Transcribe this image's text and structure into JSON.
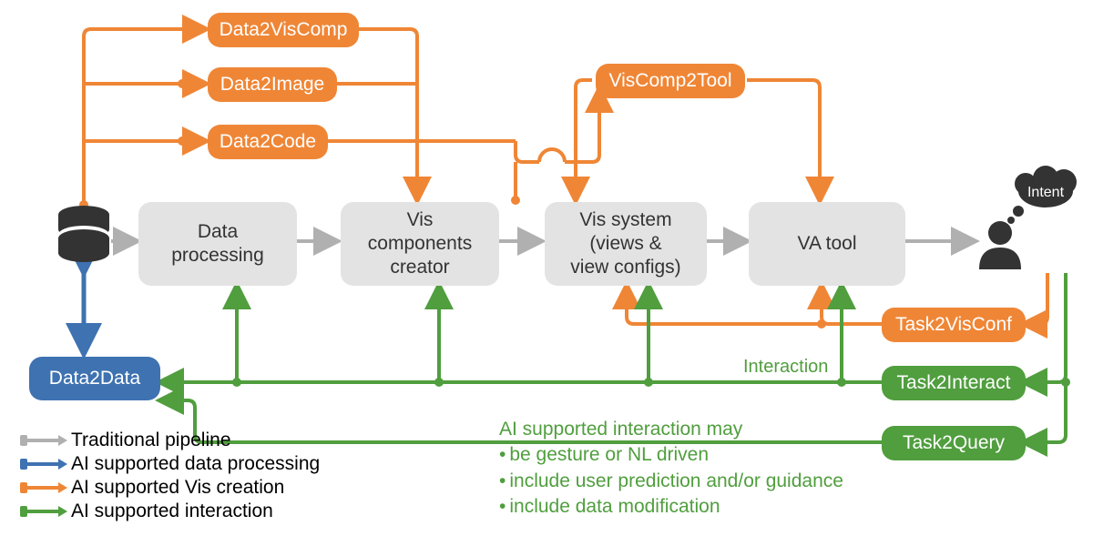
{
  "orange_boxes": {
    "data2viscomp": "Data2VisComp",
    "data2image": "Data2Image",
    "data2code": "Data2Code",
    "viscomp2tool": "VisComp2Tool",
    "task2visconf": "Task2VisConf"
  },
  "gray_boxes": {
    "data_processing": "Data\nprocessing",
    "vis_components": "Vis\ncomponents\ncreator",
    "vis_system": "Vis system\n(views &\nview configs)",
    "va_tool": "VA tool"
  },
  "blue_boxes": {
    "data2data": "Data2Data"
  },
  "green_boxes": {
    "task2interact": "Task2Interact",
    "task2query": "Task2Query"
  },
  "labels": {
    "intent": "Intent",
    "interaction": "Interaction"
  },
  "legend": {
    "traditional": "Traditional pipeline",
    "blue": "AI supported data processing",
    "orange": "AI supported Vis creation",
    "green": "AI supported interaction"
  },
  "note": {
    "title": "AI supported interaction may",
    "b1": "be gesture or NL driven",
    "b2": "include user prediction and/or guidance",
    "b3": "include data modification"
  },
  "colors": {
    "gray": "#b0b0b0",
    "orange": "#ef8636",
    "blue": "#3e72b1",
    "green": "#509e3e",
    "node_gray": "#e3e3e3",
    "dark": "#333333"
  }
}
